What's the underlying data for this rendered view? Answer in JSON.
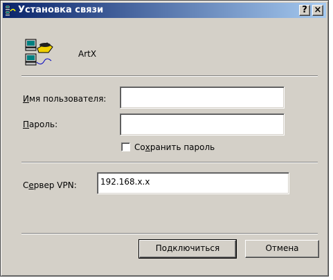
{
  "window": {
    "title": "Установка связи",
    "help_label": "?",
    "close_label": "×"
  },
  "connection": {
    "name": "ArtX"
  },
  "form": {
    "username_label_accel": "И",
    "username_label_rest": "мя пользователя:",
    "username_value": "",
    "password_label_accel": "П",
    "password_label_rest": "ароль:",
    "password_value": "",
    "save_password_pre": "Со",
    "save_password_accel": "х",
    "save_password_post": "ранить пароль",
    "save_password_checked": false,
    "server_label_pre": "С",
    "server_label_accel": "е",
    "server_label_post": "рвер VPN:",
    "server_value": "192.168.x.x"
  },
  "buttons": {
    "connect_label": "Подключиться",
    "cancel_label": "Отмена"
  },
  "colors": {
    "title_gradient_start": "#0a246a",
    "title_gradient_end": "#a6caf0",
    "face": "#d4d0c8"
  },
  "icons": {
    "title_icon": "network-computers-icon",
    "connection_icon": "dialup-phone-computers-icon"
  }
}
